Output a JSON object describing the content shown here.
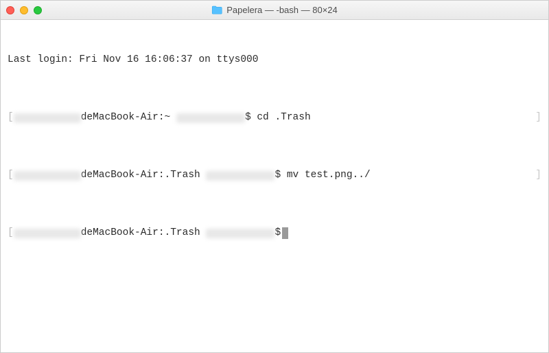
{
  "titlebar": {
    "folder_icon": "folder",
    "title": "Papelera — -bash — 80×24"
  },
  "terminal": {
    "last_login": "Last login: Fri Nov 16 16:06:37 on ttys000",
    "lines": [
      {
        "open_bracket": "[",
        "host_suffix": "deMacBook-Air:~ ",
        "prompt_symbol": "$",
        "command": " cd .Trash",
        "end_bracket": "]"
      },
      {
        "open_bracket": "[",
        "host_suffix": "deMacBook-Air:.Trash ",
        "prompt_symbol": "$",
        "command": " mv test.png../",
        "end_bracket": "]"
      },
      {
        "open_bracket": "[",
        "host_suffix": "deMacBook-Air:.Trash ",
        "prompt_symbol": "$",
        "command": "",
        "end_bracket": ""
      }
    ]
  }
}
